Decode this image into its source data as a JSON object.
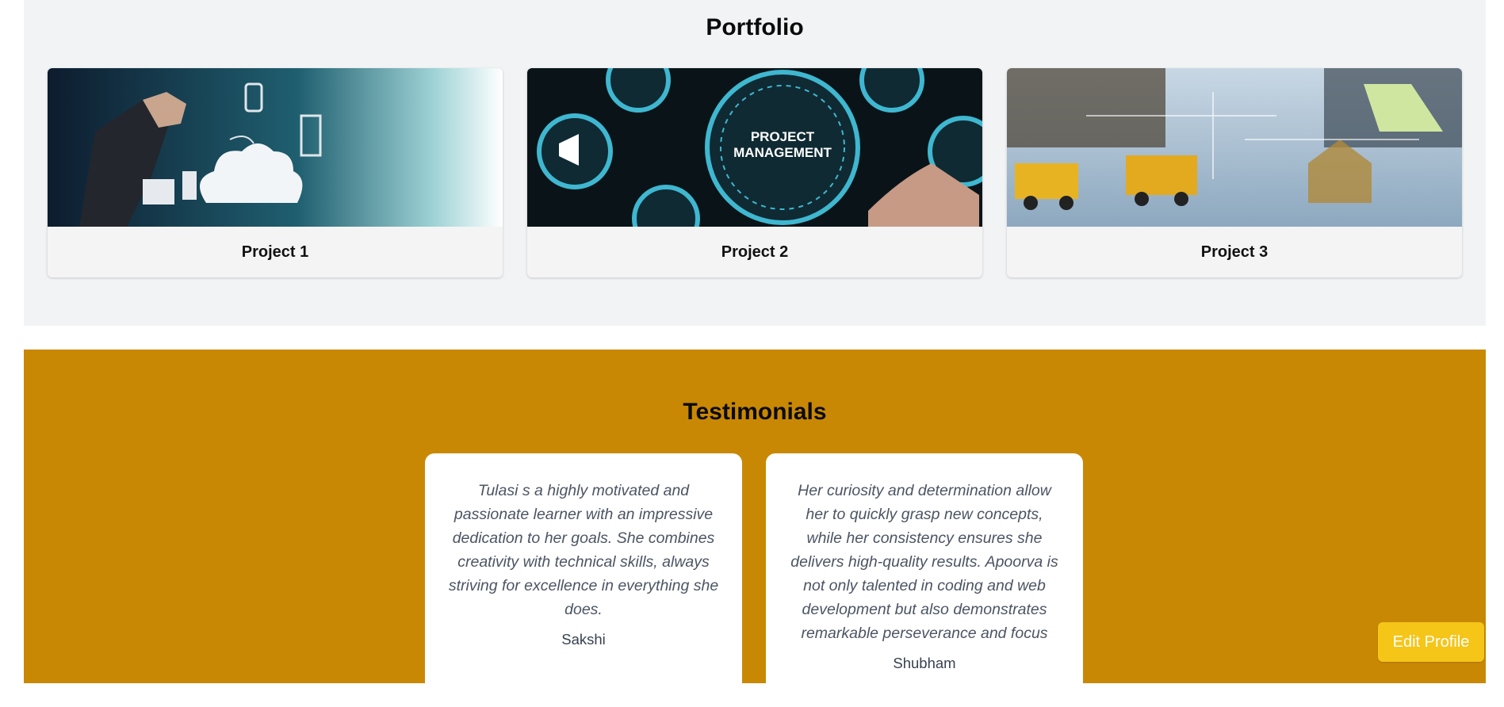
{
  "portfolio": {
    "title": "Portfolio",
    "projects": [
      {
        "label": "Project 1",
        "image": "cloud-computing-hand-image"
      },
      {
        "label": "Project 2",
        "image": "project-management-dial-image",
        "image_text": [
          "PROJECT",
          "MANAGEMENT"
        ]
      },
      {
        "label": "Project 3",
        "image": "construction-planning-image"
      }
    ]
  },
  "testimonials": {
    "title": "Testimonials",
    "items": [
      {
        "quote": "Tulasi s a highly motivated and passionate learner with an impressive dedication to her goals. She combines creativity with technical skills, always striving for excellence in everything she does.",
        "author": "Sakshi"
      },
      {
        "quote": "Her curiosity and determination allow her to quickly grasp new concepts, while her consistency ensures she delivers high-quality results. Apoorva is not only talented in coding and web development but also demonstrates remarkable perseverance and focus",
        "author": "Shubham"
      }
    ]
  },
  "actions": {
    "edit_profile_label": "Edit Profile"
  },
  "colors": {
    "portfolio_bg": "#f2f3f5",
    "testimonials_bg": "#c98804",
    "edit_button_bg": "#f5c518"
  }
}
